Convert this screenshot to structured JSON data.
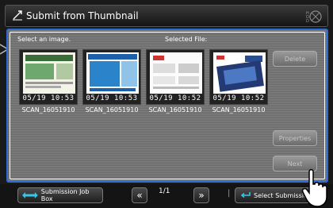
{
  "header": {
    "title": "Submit from Thumbnail"
  },
  "labels": {
    "select_image": "Select an image.",
    "selected_file": "Selected File:"
  },
  "thumbnails": [
    {
      "date": "05/19 10:53",
      "name": "SCAN_16051910"
    },
    {
      "date": "05/19 10:53",
      "name": "SCAN_16051910"
    },
    {
      "date": "05/19 10:52",
      "name": "SCAN_16051910"
    },
    {
      "date": "05/19 10:52",
      "name": "SCAN_16051910"
    }
  ],
  "side": {
    "delete": "Delete",
    "properties": "Properties",
    "next": "Next"
  },
  "footer": {
    "submission_job_box": "Submission Job Box",
    "page": "1/1",
    "select_submission": "Select Submission"
  },
  "colors": {
    "accent": "#2e6bd6"
  }
}
